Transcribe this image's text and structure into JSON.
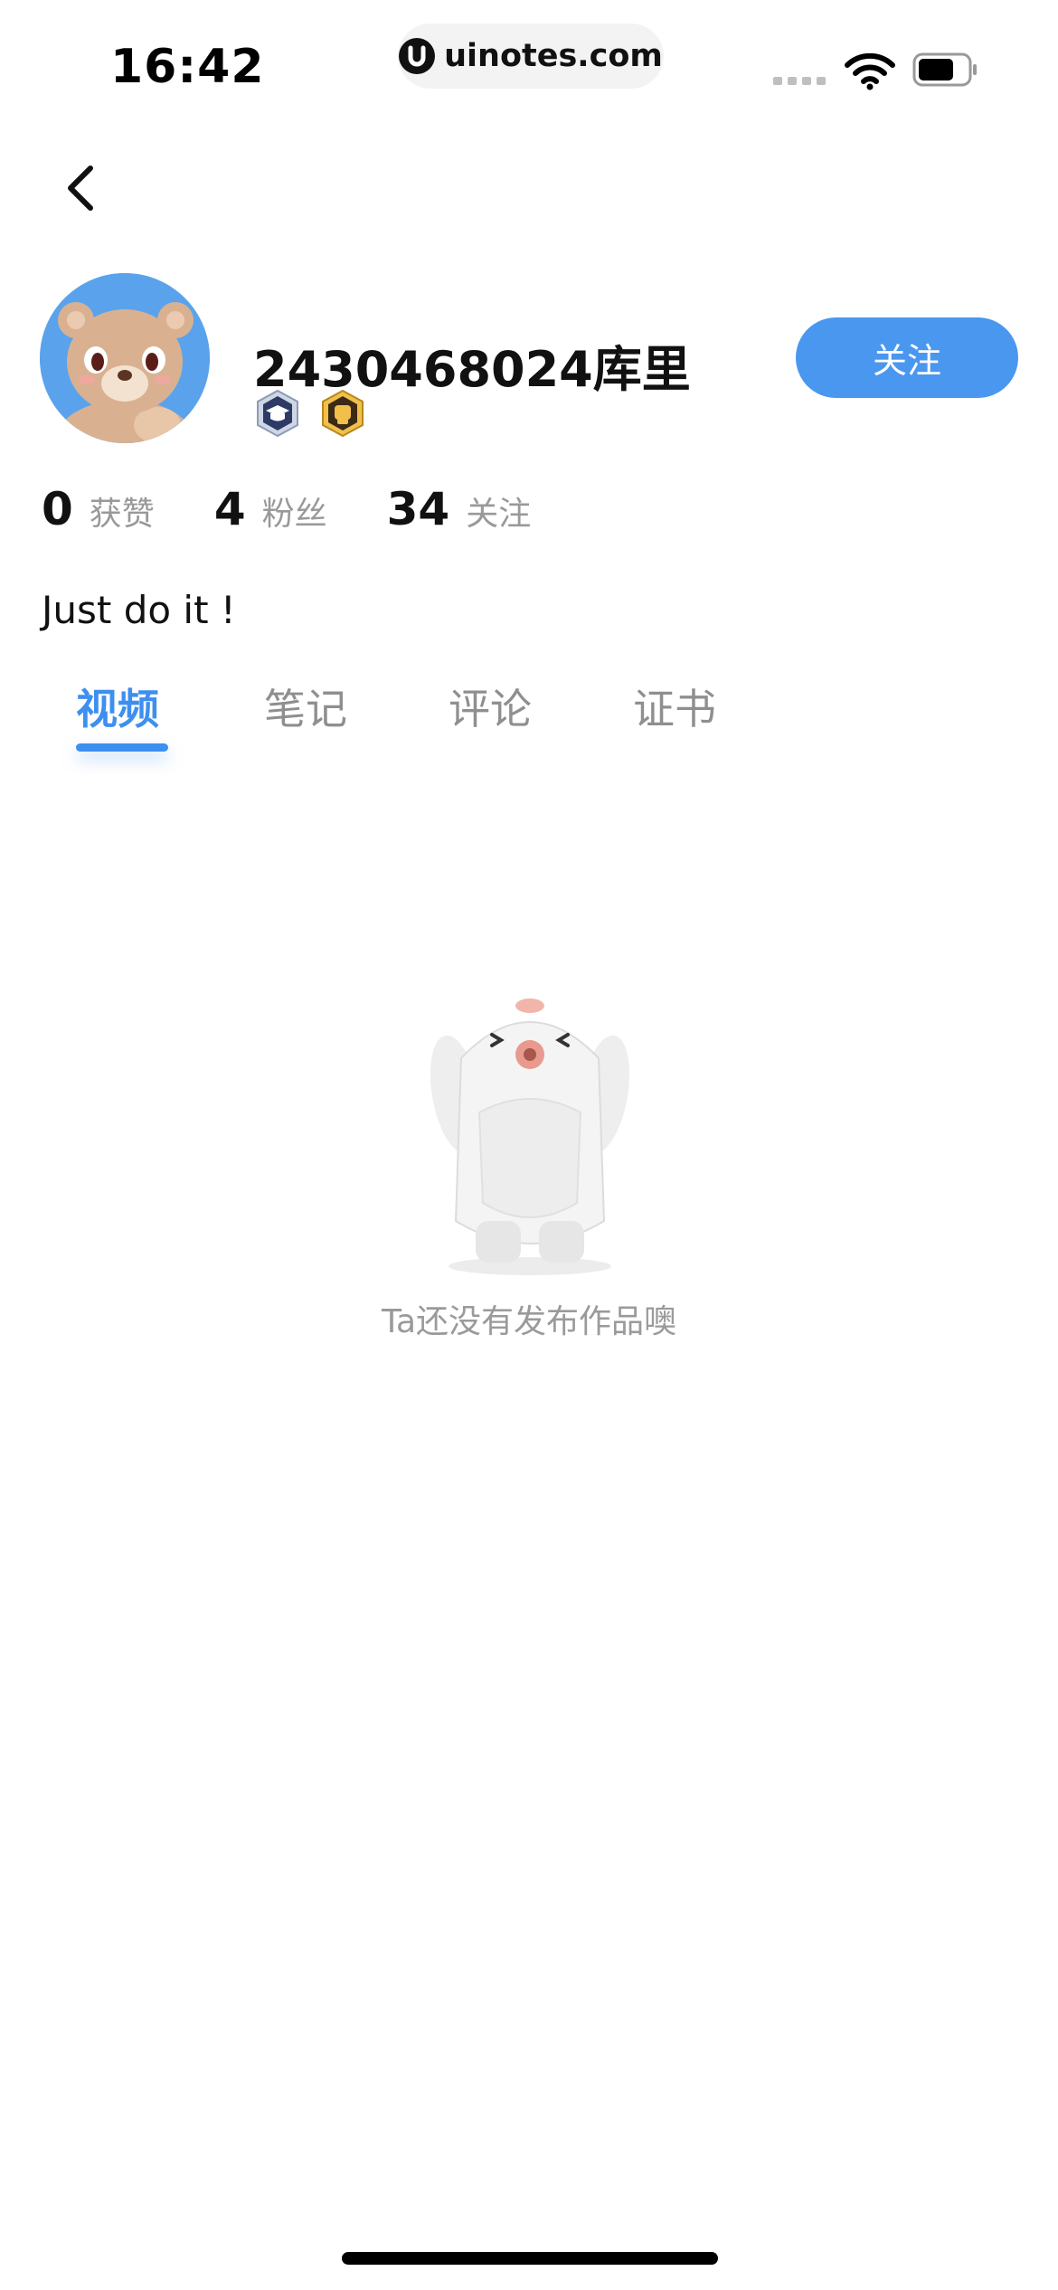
{
  "status_bar": {
    "time": "16:42",
    "url": "uinotes.com",
    "url_logo_letter": "U",
    "icons": [
      "signal-icon",
      "wifi-icon",
      "battery-icon"
    ]
  },
  "nav": {
    "back_icon": "chevron-left-icon"
  },
  "profile": {
    "username": "2430468024库里",
    "follow_label": "关注",
    "badges": [
      "hexagon-cap-badge",
      "hexagon-fist-badge"
    ],
    "bio": "Just do it !"
  },
  "stats": [
    {
      "value": "0",
      "label": "获赞"
    },
    {
      "value": "4",
      "label": "粉丝"
    },
    {
      "value": "34",
      "label": "关注"
    }
  ],
  "tabs": [
    {
      "label": "视频",
      "active": true
    },
    {
      "label": "笔记",
      "active": false
    },
    {
      "label": "评论",
      "active": false
    },
    {
      "label": "证书",
      "active": false
    }
  ],
  "empty_state": {
    "message": "Ta还没有发布作品噢",
    "illustration": "white-bird-mascot"
  },
  "colors": {
    "accent": "#4a97f0",
    "tab_active": "#3d8ff0",
    "muted_text": "#999999",
    "avatar_bg": "#5aa3ec"
  }
}
